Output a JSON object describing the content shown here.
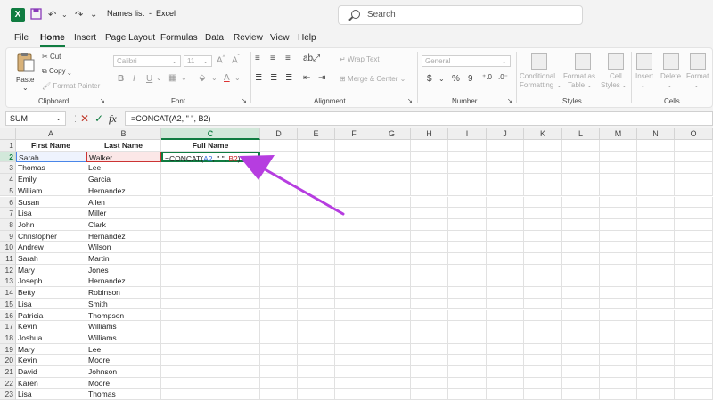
{
  "titlebar": {
    "app_logo": "X",
    "document_title": "Names list",
    "separator": "-",
    "app_name": "Excel",
    "search_placeholder": "Search"
  },
  "tabs": [
    "File",
    "Home",
    "Insert",
    "Page Layout",
    "Formulas",
    "Data",
    "Review",
    "View",
    "Help"
  ],
  "active_tab": "Home",
  "ribbon": {
    "clipboard": {
      "label": "Clipboard",
      "paste": "Paste",
      "cut": "Cut",
      "copy": "Copy",
      "format_painter": "Format Painter"
    },
    "font": {
      "label": "Font",
      "font_name": "Calibri",
      "font_size": "11",
      "bold": "B",
      "italic": "I",
      "underline": "U"
    },
    "alignment": {
      "label": "Alignment",
      "wrap_text": "Wrap Text",
      "merge_center": "Merge & Center"
    },
    "number": {
      "label": "Number",
      "format": "General",
      "currency": "$",
      "percent": "%",
      "comma": "9"
    },
    "styles": {
      "label": "Styles",
      "conditional_formatting_1": "Conditional",
      "conditional_formatting_2": "Formatting",
      "format_as_table_1": "Format as",
      "format_as_table_2": "Table",
      "cell_styles_1": "Cell",
      "cell_styles_2": "Styles"
    },
    "cells": {
      "label": "Cells",
      "insert": "Insert",
      "delete": "Delete",
      "format": "Format"
    }
  },
  "formula_bar": {
    "name_box": "SUM",
    "cancel": "✕",
    "enter": "✓",
    "fx": "fx",
    "formula": "=CONCAT(A2, \" \", B2)"
  },
  "columns": [
    "A",
    "B",
    "C",
    "D",
    "E",
    "F",
    "G",
    "H",
    "I",
    "J",
    "K",
    "L",
    "M",
    "N",
    "O"
  ],
  "rows": [
    "1",
    "2",
    "3",
    "4",
    "5",
    "6",
    "7",
    "8",
    "9",
    "10",
    "11",
    "12",
    "13",
    "14",
    "15",
    "16",
    "17",
    "18",
    "19",
    "20",
    "21",
    "22",
    "23"
  ],
  "headers": {
    "a": "First Name",
    "b": "Last Name",
    "c": "Full Name"
  },
  "active_cell_formula": {
    "prefix": "=CONCAT(",
    "ref1": "A2",
    "middle": ", \" \", ",
    "ref2": "B2",
    "suffix": ")"
  },
  "names": [
    [
      "Sarah",
      "Walker"
    ],
    [
      "Thomas",
      "Lee"
    ],
    [
      "Emily",
      "Garcia"
    ],
    [
      "William",
      "Hernandez"
    ],
    [
      "Susan",
      "Allen"
    ],
    [
      "Lisa",
      "Miller"
    ],
    [
      "John",
      "Clark"
    ],
    [
      "Christopher",
      "Hernandez"
    ],
    [
      "Andrew",
      "Wilson"
    ],
    [
      "Sarah",
      "Martin"
    ],
    [
      "Mary",
      "Jones"
    ],
    [
      "Joseph",
      "Hernandez"
    ],
    [
      "Betty",
      "Robinson"
    ],
    [
      "Lisa",
      "Smith"
    ],
    [
      "Patricia",
      "Thompson"
    ],
    [
      "Kevin",
      "Williams"
    ],
    [
      "Joshua",
      "Williams"
    ],
    [
      "Mary",
      "Lee"
    ],
    [
      "Kevin",
      "Moore"
    ],
    [
      "David",
      "Johnson"
    ],
    [
      "Karen",
      "Moore"
    ],
    [
      "Lisa",
      "Thomas"
    ]
  ],
  "colors": {
    "accent": "#107c41",
    "ref_a": "#4a86e8",
    "ref_b": "#cc3333",
    "annotation_arrow": "#b63de0"
  }
}
